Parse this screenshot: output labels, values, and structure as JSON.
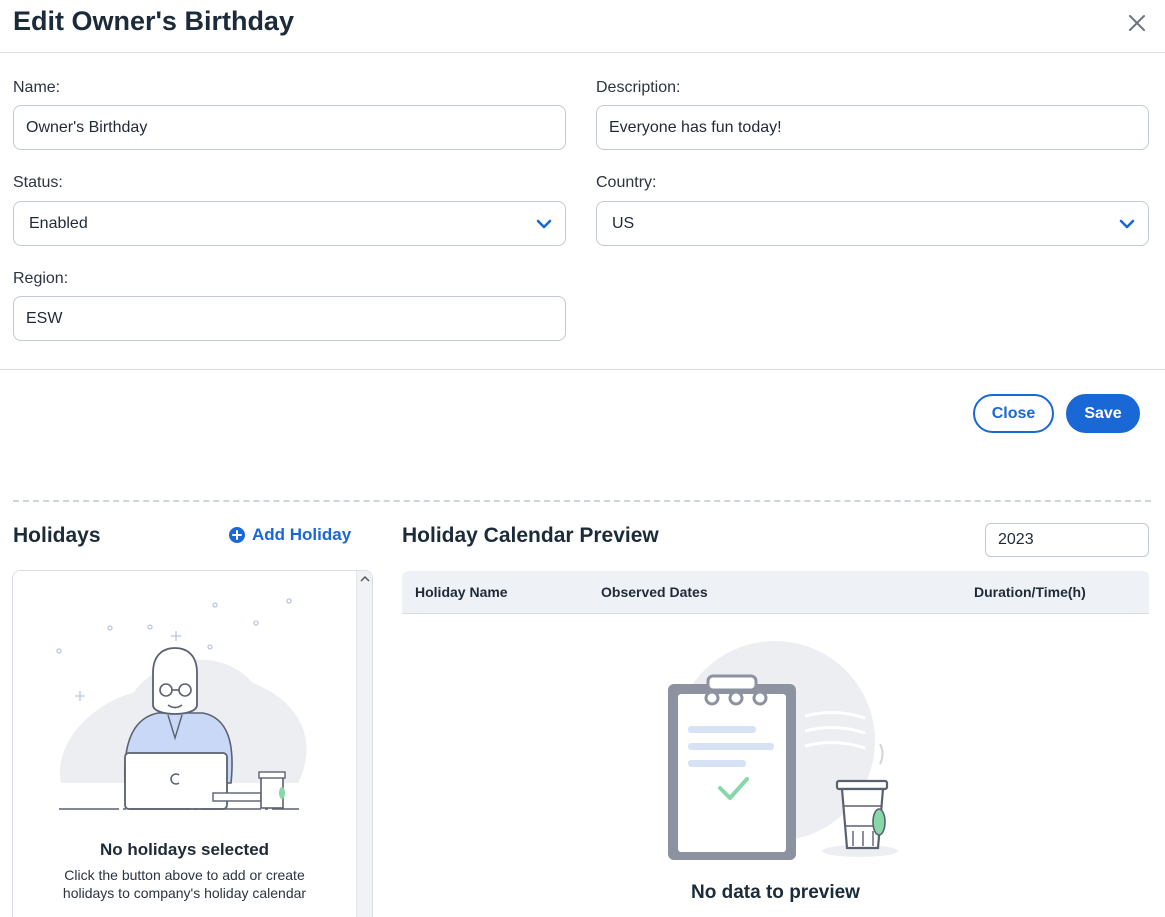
{
  "dialog": {
    "title": "Edit Owner's Birthday"
  },
  "form": {
    "name": {
      "label": "Name:",
      "value": "Owner's Birthday"
    },
    "description": {
      "label": "Description:",
      "value": "Everyone has fun today!"
    },
    "status": {
      "label": "Status:",
      "value": "Enabled"
    },
    "country": {
      "label": "Country:",
      "value": "US"
    },
    "region": {
      "label": "Region:",
      "value": "ESW"
    }
  },
  "actions": {
    "close_label": "Close",
    "save_label": "Save"
  },
  "holidays": {
    "title": "Holidays",
    "add_label": "Add Holiday",
    "empty_title": "No holidays selected",
    "empty_desc_line1": "Click the button above to add or create",
    "empty_desc_line2": "holidays to company's holiday calendar"
  },
  "preview": {
    "title": "Holiday Calendar Preview",
    "year": "2023",
    "columns": [
      "Holiday Name",
      "Observed Dates",
      "Duration/Time(h)"
    ],
    "empty_text": "No data to preview"
  },
  "colors": {
    "accent": "#1a67d6",
    "text": "#1c2b3a",
    "border": "#c3cad3"
  },
  "icons": [
    "close-icon",
    "chevron-down-icon",
    "plus-circle-icon",
    "scroll-up-icon",
    "person-laptop-illustration",
    "clipboard-illustration"
  ]
}
